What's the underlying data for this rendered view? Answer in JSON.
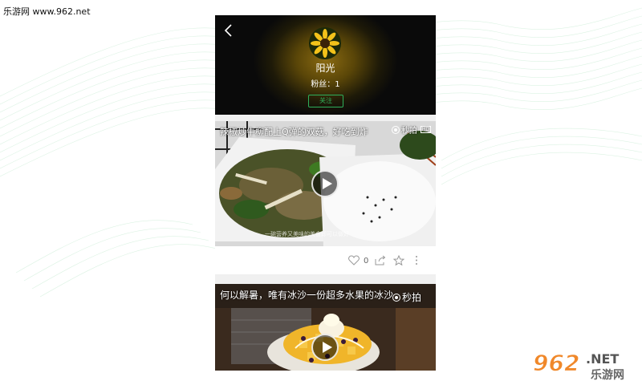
{
  "site": {
    "watermark_text": "乐游网 www.962.net",
    "logo_number": "962",
    "logo_net": ".NET",
    "logo_cn": "乐游网"
  },
  "profile": {
    "username": "阳光",
    "fans_label": "粉丝：1",
    "follow_label": "关注"
  },
  "videos": [
    {
      "title": "辣椒炒牛柳配上Q弹的双菇，好吃到炸",
      "brand": "秒拍",
      "hd": "HD",
      "caption": "一碗营养又美味的美食即可以做好",
      "likes": "0"
    },
    {
      "title": "何以解暑，唯有冰沙一份超多水果的冰沙",
      "brand": "秒拍"
    }
  ],
  "colors": {
    "accent": "#2eae5a",
    "logo_orange": "#f0882a"
  }
}
